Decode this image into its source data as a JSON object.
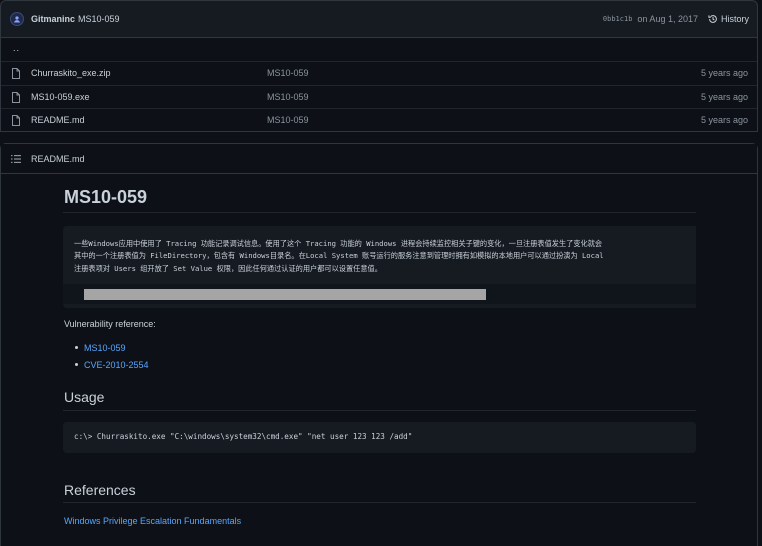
{
  "commit": {
    "author": "Gitmaninc",
    "message": "MS10-059",
    "sha": "0bb1c1b",
    "date": "on Aug 1, 2017",
    "history_label": "History"
  },
  "files": {
    "parent": "..",
    "rows": [
      {
        "name": "Churraskito_exe.zip",
        "commit": "MS10-059",
        "age": "5 years ago"
      },
      {
        "name": "MS10-059.exe",
        "commit": "MS10-059",
        "age": "5 years ago"
      },
      {
        "name": "README.md",
        "commit": "MS10-059",
        "age": "5 years ago"
      }
    ]
  },
  "readme": {
    "filename": "README.md",
    "title": "MS10-059",
    "code_lines": [
      "一些Windows应用中使用了 Tracing 功能记录调试信息。使用了这个 Tracing 功能的 Windows 进程会持续监控相关子键的变化，一旦注册表值发生了变化就会",
      "其中的一个注册表值为 FileDirectory，包含有 Windows目录名。在Local System 账号运行的服务注意到管理时拥有如模拟的本地用户可以通过扮演为 Local",
      "注册表项对 Users 组开放了 Set Value 权限，因此任何通过认证的用户都可以设置任意值。"
    ],
    "scroll_fraction": 0.64,
    "vuln_ref_label": "Vulnerability reference:",
    "vuln_links": [
      "MS10-059",
      "CVE-2010-2554"
    ],
    "usage_heading": "Usage",
    "usage_command": "c:\\> Churraskito.exe \"C:\\windows\\system32\\cmd.exe\" \"net user 123 123 /add\"",
    "refs_heading": "References",
    "ref_link": "Windows Privilege Escalation Fundamentals"
  },
  "colors": {
    "background": "#0d1117",
    "header": "#161b22",
    "border": "#30363d",
    "text": "#c9d1d9",
    "muted": "#8b949e",
    "link": "#58a6ff"
  },
  "icons": {
    "author": "avatar-icon",
    "history": "history-clock-icon",
    "file": "file-icon",
    "readme": "list-icon"
  }
}
